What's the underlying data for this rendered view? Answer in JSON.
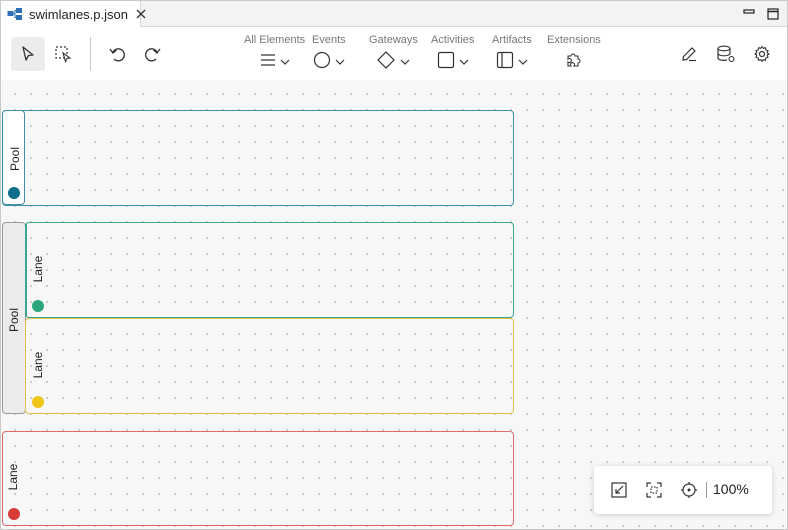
{
  "tab": {
    "title": "swimlanes.p.json",
    "icon": "bpmn-diagram-icon"
  },
  "toolbar": {
    "palettes": [
      {
        "label": "All Elements",
        "icon": "menu-icon"
      },
      {
        "label": "Events",
        "icon": "circle-icon"
      },
      {
        "label": "Gateways",
        "icon": "diamond-icon"
      },
      {
        "label": "Activities",
        "icon": "square-icon"
      },
      {
        "label": "Artifacts",
        "icon": "panel-icon"
      },
      {
        "label": "Extensions",
        "icon": "puzzle-icon"
      }
    ],
    "tools": [
      "select-pointer-icon",
      "marquee-select-icon",
      "undo-icon",
      "redo-icon",
      "edit-icon",
      "database-icon",
      "settings-icon"
    ]
  },
  "diagram": {
    "pool1": {
      "label": "Pool",
      "color": "#0f6d8c"
    },
    "pool2": {
      "label": "Pool",
      "color": "#888888"
    },
    "lane_green": {
      "label": "Lane",
      "color": "#2aa57e"
    },
    "lane_yellow": {
      "label": "Lane",
      "color": "#f0c419"
    },
    "lane_red": {
      "label": "Lane",
      "color": "#d93b3b"
    }
  },
  "zoom": {
    "level": "100%",
    "tools": [
      "fit-icon",
      "center-selection-icon",
      "origin-icon"
    ]
  },
  "colors": {
    "pool1_border": "#3e8fa8",
    "lane_green_border": "#3aa891",
    "lane_yellow_border": "#e3c24a",
    "lane_red_border": "#e06a6a"
  }
}
